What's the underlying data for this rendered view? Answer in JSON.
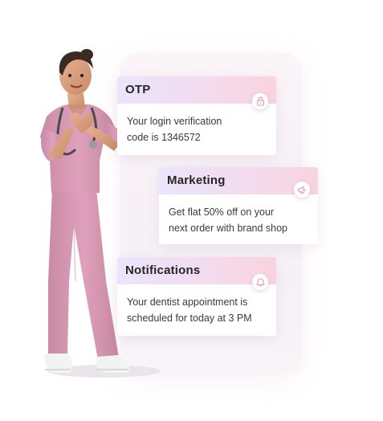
{
  "cards": {
    "otp": {
      "title": "OTP",
      "body_line1": "Your login verification",
      "body_line2": "code is 1346572",
      "icon": "lock-icon"
    },
    "marketing": {
      "title": "Marketing",
      "body_line1": "Get flat 50% off on your",
      "body_line2": "next order with brand shop",
      "icon": "megaphone-icon"
    },
    "notifications": {
      "title": "Notifications",
      "body_line1": "Your dentist appointment is",
      "body_line2": "scheduled for today at 3 PM",
      "icon": "bell-icon"
    }
  },
  "colors": {
    "header_gradient_start": "#ece4fb",
    "header_gradient_end": "#f9d3de",
    "scrubs": "#d89ab6",
    "icon_stroke": "#d79ab8"
  }
}
